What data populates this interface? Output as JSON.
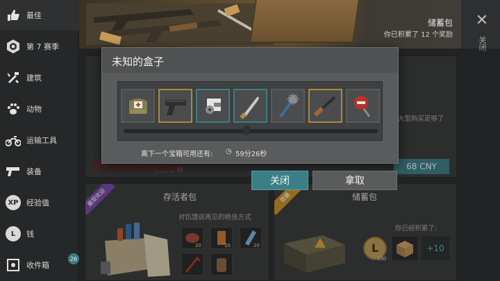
{
  "sidebar": {
    "items": [
      {
        "label": "最佳",
        "icon": "thumbs-up-icon"
      },
      {
        "label": "第 7 赛季",
        "icon": "season-badge-icon"
      },
      {
        "label": "建筑",
        "icon": "hammer-wrench-icon"
      },
      {
        "label": "动物",
        "icon": "paw-icon"
      },
      {
        "label": "运输工具",
        "icon": "motorcycle-icon"
      },
      {
        "label": "装备",
        "icon": "pistol-icon"
      },
      {
        "label": "经验值",
        "icon": "xp-icon"
      },
      {
        "label": "钱",
        "icon": "coin-icon"
      },
      {
        "label": "收件箱",
        "icon": "inbox-icon"
      }
    ],
    "inbox_badge": "26"
  },
  "banner": {
    "title": "储蓄包",
    "subtitle": "你已积累了 12 个奖励"
  },
  "close": {
    "vertical_label": "关闭"
  },
  "background": {
    "top_card_timer": "59分17秒",
    "top_card_desc": "大型购买足够了",
    "top_card_price": "68 CNY",
    "survivor_card": {
      "ribbon": "最受欢迎",
      "title": "存活者包",
      "desc": "对饥饿说再见的绝佳方式",
      "slots": [
        "20",
        "20",
        "20",
        "",
        ""
      ]
    },
    "savings_card": {
      "ribbon": "限量",
      "title": "储蓄包",
      "desc": "你已经积累了:",
      "coin_count": "100",
      "plus": "+10"
    }
  },
  "modal": {
    "title": "未知的盒子",
    "items": [
      {
        "name": "first-aid-bag",
        "rarity": "common"
      },
      {
        "name": "pistol",
        "rarity": "gold"
      },
      {
        "name": "metal-parts",
        "rarity": "teal"
      },
      {
        "name": "machete",
        "rarity": "teal"
      },
      {
        "name": "spiked-mace",
        "rarity": "common"
      },
      {
        "name": "shotgun",
        "rarity": "gold"
      },
      {
        "name": "stop-sign-axe",
        "rarity": "common"
      }
    ],
    "timer_label": "离下一个宝箱可用还有:",
    "timer_value": "59分26秒",
    "close_label": "关闭",
    "take_label": "拿取"
  }
}
